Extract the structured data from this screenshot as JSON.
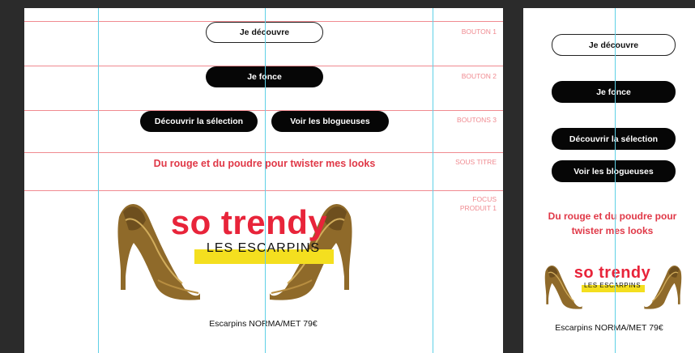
{
  "buttons": {
    "decouvre": "Je découvre",
    "fonce": "Je fonce",
    "selection": "Découvrir la sélection",
    "blogueuses": "Voir les blogueuses"
  },
  "sections": {
    "bouton1": "BOUTON 1",
    "bouton2": "BOUTON 2",
    "boutons3": "BOUTONS 3",
    "sous_titre": "SOUS TITRE",
    "focus_produit": "FOCUS PRODUIT 1"
  },
  "subtitle": "Du rouge et du poudre pour twister mes looks",
  "product": {
    "title": "so trendy",
    "subtitle": "LES ESCARPINS",
    "caption": "Escarpins NORMA/MET 79€"
  },
  "colors": {
    "guide_horizontal": "#f08a90",
    "guide_vertical": "#5fd0e6",
    "accent_red": "#e8243a",
    "highlight_yellow": "#f4df1f",
    "shoe_bronze": "#8f6a2a"
  },
  "icons": [
    "high-heel-shoe-icon"
  ]
}
